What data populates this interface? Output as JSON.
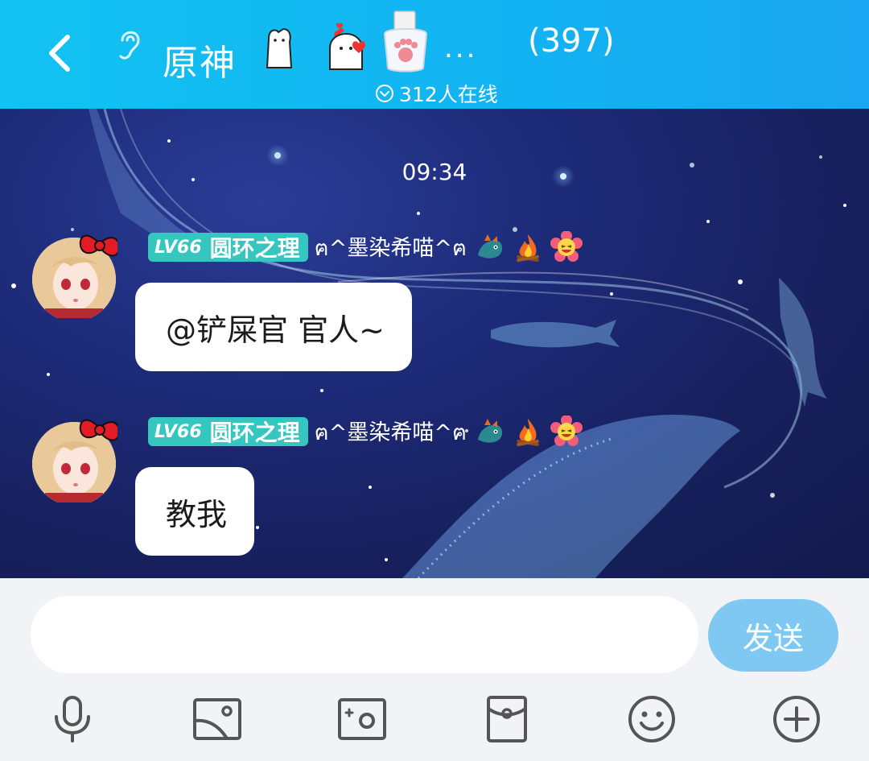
{
  "header": {
    "title": "原神",
    "more": "...",
    "member_count": "(397)",
    "online": "312人在线"
  },
  "chat": {
    "time": "09:34",
    "messages": [
      {
        "level": "LV66",
        "title_tag": "圆环之理",
        "nickname": "ฅ^墨染希喵^ฅ",
        "text": "@铲屎官 官人~"
      },
      {
        "level": "LV66",
        "title_tag": "圆环之理",
        "nickname": "ฅ^墨染希喵^ฅ",
        "text": "教我"
      }
    ]
  },
  "composer": {
    "input_value": "",
    "send_label": "发送",
    "tools": [
      "microphone-icon",
      "image-icon",
      "camera-icon",
      "red-packet-icon",
      "emoji-icon",
      "plus-icon"
    ]
  },
  "colors": {
    "header": "#12c2f2",
    "badge": "#35c6c0",
    "send_button": "#7ec8f2",
    "chat_bg": "#1d2a78"
  }
}
